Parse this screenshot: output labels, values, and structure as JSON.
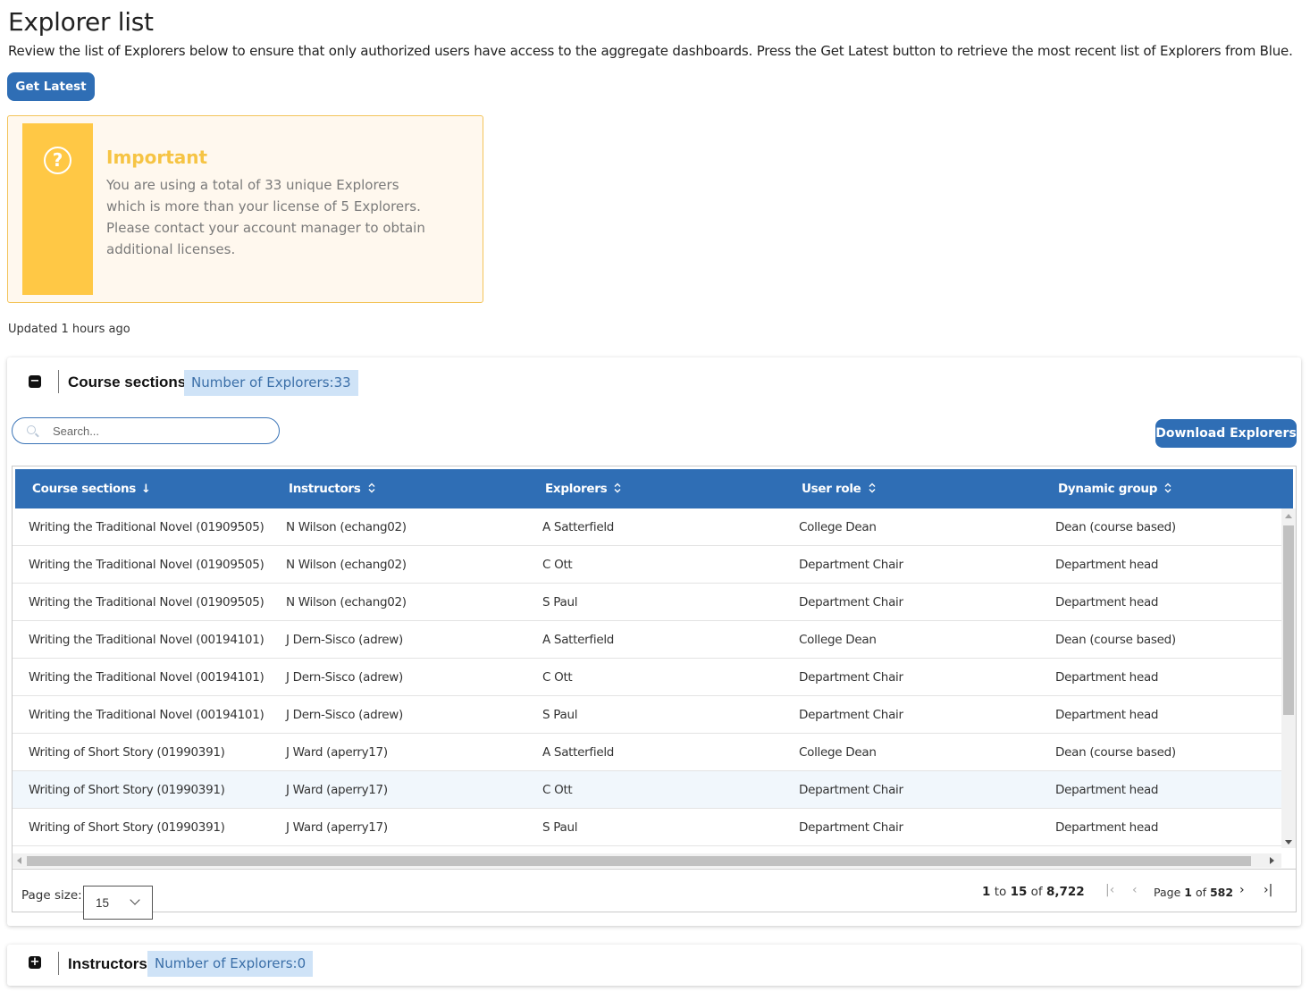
{
  "page": {
    "title": "Explorer list",
    "intro": "Review the list of Explorers below to ensure that only authorized users have access to the aggregate dashboards. Press the Get Latest button to retrieve the most recent list of Explorers from Blue.",
    "get_latest_label": "Get Latest",
    "updated_text": "Updated 1 hours ago"
  },
  "important": {
    "icon": "question-circle-icon",
    "title": "Important",
    "message": "You are using a total of 33 unique Explorers which is more than your license of 5 Explorers. Please contact your account manager to obtain additional licenses.",
    "accent_color": "#ffc845"
  },
  "course_panel": {
    "toggle_icon": "minus-icon",
    "title": "Course sections",
    "badge": "Number of Explorers:33",
    "search_placeholder": "Search...",
    "download_label": "Download Explorers",
    "columns": [
      "Course sections",
      "Instructors",
      "Explorers",
      "User role",
      "Dynamic group"
    ],
    "sort_active_icon": "arrow-down-icon",
    "sort_idle_icon": "sort-updown-icon",
    "rows": [
      [
        "Writing the Traditional Novel (01909505)",
        "N Wilson (echang02)",
        "A Satterfield",
        "College Dean",
        "Dean (course based)"
      ],
      [
        "Writing the Traditional Novel (01909505)",
        "N Wilson (echang02)",
        "C Ott",
        "Department Chair",
        "Department head"
      ],
      [
        "Writing the Traditional Novel (01909505)",
        "N Wilson (echang02)",
        "S Paul",
        "Department Chair",
        "Department head"
      ],
      [
        "Writing the Traditional Novel (00194101)",
        "J Dern-Sisco (adrew)",
        "A Satterfield",
        "College Dean",
        "Dean (course based)"
      ],
      [
        "Writing the Traditional Novel (00194101)",
        "J Dern-Sisco (adrew)",
        "C Ott",
        "Department Chair",
        "Department head"
      ],
      [
        "Writing the Traditional Novel (00194101)",
        "J Dern-Sisco (adrew)",
        "S Paul",
        "Department Chair",
        "Department head"
      ],
      [
        "Writing of Short Story (01990391)",
        "J Ward (aperry17)",
        "A Satterfield",
        "College Dean",
        "Dean (course based)"
      ],
      [
        "Writing of Short Story (01990391)",
        "J Ward (aperry17)",
        "C Ott",
        "Department Chair",
        "Department head"
      ],
      [
        "Writing of Short Story (01990391)",
        "J Ward (aperry17)",
        "S Paul",
        "Department Chair",
        "Department head"
      ]
    ],
    "selected_row_index": 7,
    "footer": {
      "page_size_label": "Page size:",
      "page_size_value": "15",
      "range_from": "1",
      "range_to_word": "to",
      "range_to": "15",
      "of_word": "of",
      "total": "8,722",
      "page_word": "Page",
      "page_current": "1",
      "page_total": "582"
    }
  },
  "instructors_panel": {
    "toggle_icon": "plus-icon",
    "title": "Instructors",
    "badge": "Number of Explorers:0"
  },
  "colors": {
    "primary": "#2f6eb5",
    "badge_bg": "#cfe3f7",
    "badge_text": "#3b6fa8",
    "important_title": "#f6c444"
  }
}
